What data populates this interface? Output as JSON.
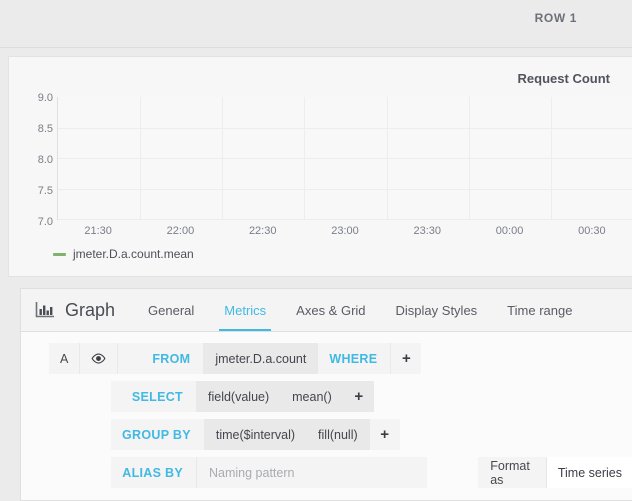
{
  "row": {
    "title": "ROW 1"
  },
  "graph_panel": {
    "title": "Request Count",
    "legend": {
      "label": "jmeter.D.a.count.mean",
      "color": "#7eb26d"
    }
  },
  "chart_data": {
    "type": "line",
    "title": "Request Count",
    "xlabel": "",
    "ylabel": "",
    "x_ticks": [
      "21:30",
      "22:00",
      "22:30",
      "23:00",
      "23:30",
      "00:00",
      "00:30"
    ],
    "y_ticks": [
      "7.0",
      "7.5",
      "8.0",
      "8.5",
      "9.0"
    ],
    "ylim": [
      7.0,
      9.0
    ],
    "grid": true,
    "legend_position": "bottom-left",
    "series": [
      {
        "name": "jmeter.D.a.count.mean",
        "color": "#7eb26d",
        "x": [],
        "values": []
      }
    ]
  },
  "editor": {
    "panel_type": "Graph",
    "panel_icon": "bar-chart-icon",
    "tabs": [
      {
        "label": "General",
        "active": false
      },
      {
        "label": "Metrics",
        "active": true
      },
      {
        "label": "Axes & Grid",
        "active": false
      },
      {
        "label": "Display Styles",
        "active": false
      },
      {
        "label": "Time range",
        "active": false
      }
    ],
    "accent_color": "#41b9e3",
    "query": {
      "ref_id": "A",
      "eye_icon": "eye-icon",
      "from_label": "FROM",
      "from_value": "jmeter.D.a.count",
      "where_label": "WHERE",
      "where_add": "+",
      "select_label": "SELECT",
      "select_parts": [
        "field(value)",
        "mean()"
      ],
      "select_add": "+",
      "group_by_label": "GROUP BY",
      "group_by_parts": [
        "time($interval)",
        "fill(null)"
      ],
      "group_by_add": "+",
      "alias_by_label": "ALIAS BY",
      "alias_by_value": "",
      "alias_by_placeholder": "Naming pattern",
      "format_as_label": "Format as",
      "format_as_value": "Time series"
    }
  }
}
